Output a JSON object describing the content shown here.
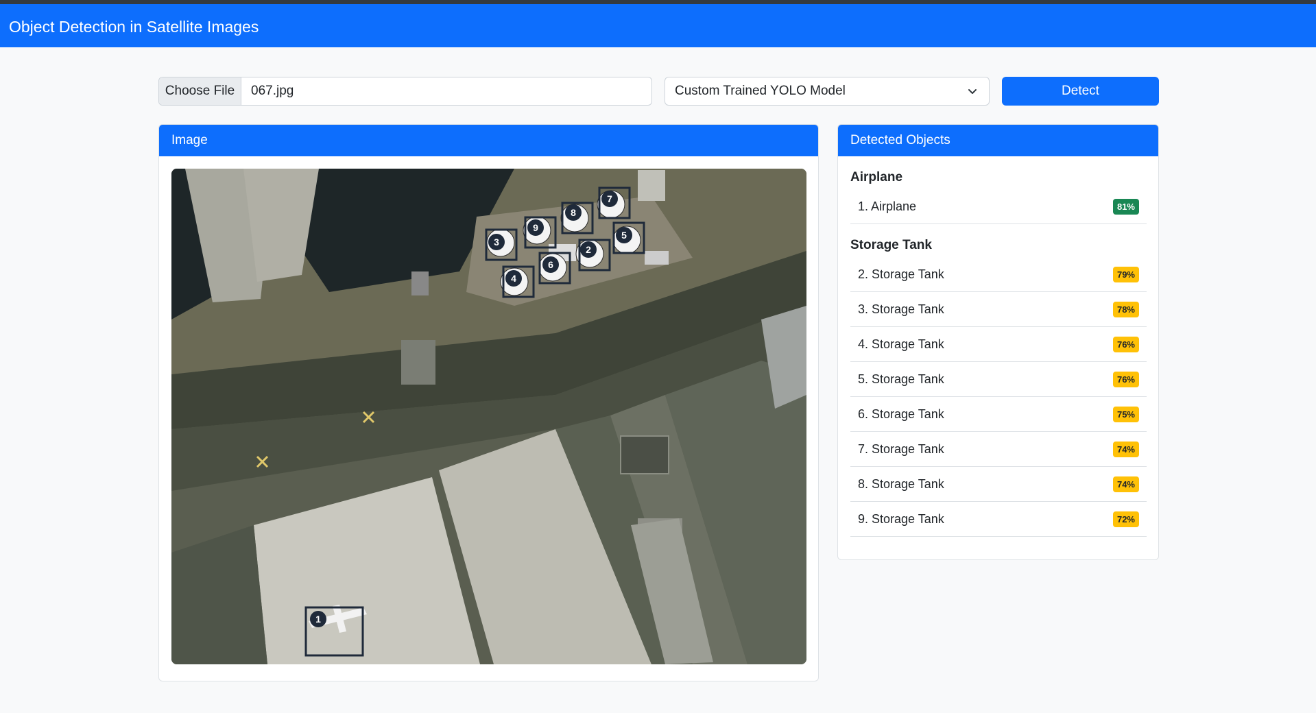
{
  "app": {
    "title": "Object Detection in Satellite Images"
  },
  "controls": {
    "file_button": "Choose File",
    "file_name": "067.jpg",
    "model_select": "Custom Trained YOLO Model",
    "detect_button": "Detect"
  },
  "image_panel": {
    "header": "Image"
  },
  "detections_panel": {
    "header": "Detected Objects",
    "categories": [
      {
        "title": "Airplane",
        "items": [
          {
            "label": "1. Airplane",
            "confidence": "81%"
          }
        ]
      },
      {
        "title": "Storage Tank",
        "items": [
          {
            "label": "2. Storage Tank",
            "confidence": "79%"
          },
          {
            "label": "3. Storage Tank",
            "confidence": "78%"
          },
          {
            "label": "4. Storage Tank",
            "confidence": "76%"
          },
          {
            "label": "5. Storage Tank",
            "confidence": "76%"
          },
          {
            "label": "6. Storage Tank",
            "confidence": "75%"
          },
          {
            "label": "7. Storage Tank",
            "confidence": "74%"
          },
          {
            "label": "8. Storage Tank",
            "confidence": "74%"
          },
          {
            "label": "9. Storage Tank",
            "confidence": "72%"
          }
        ]
      }
    ]
  },
  "box_labels": [
    "1",
    "2",
    "3",
    "4",
    "5",
    "6",
    "7",
    "8",
    "9"
  ],
  "colors": {
    "primary": "#0d6efd",
    "badge_high": "#198754",
    "badge_mid": "#ffc107",
    "box_stroke": "#1f2a3a"
  }
}
